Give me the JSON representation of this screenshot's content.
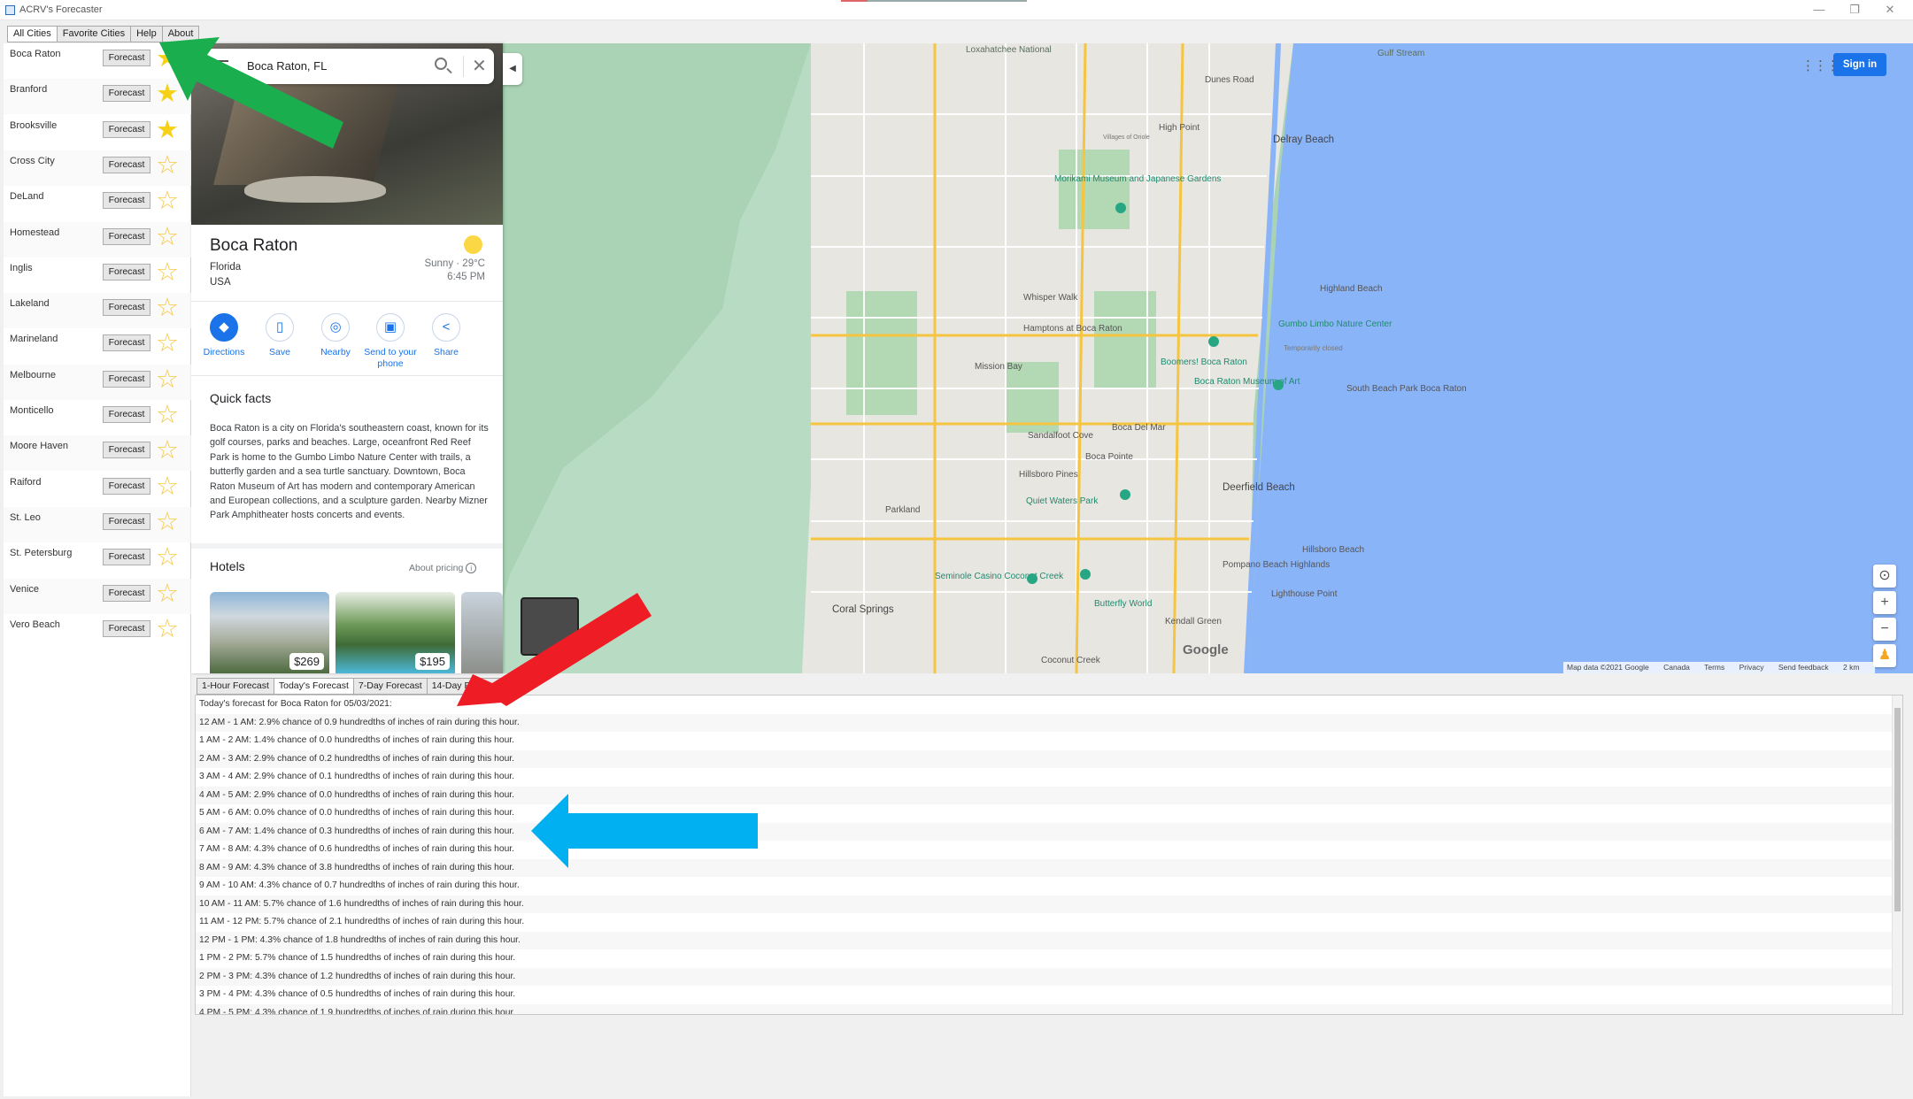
{
  "window": {
    "title": "ACRV's Forecaster"
  },
  "top_tabs": [
    "All Cities",
    "Favorite Cities",
    "Help",
    "About"
  ],
  "forecast_button_label": "Forecast",
  "cities": [
    {
      "name": "Boca Raton",
      "favorite": true
    },
    {
      "name": "Branford",
      "favorite": true
    },
    {
      "name": "Brooksville",
      "favorite": true
    },
    {
      "name": "Cross City",
      "favorite": false
    },
    {
      "name": "DeLand",
      "favorite": false
    },
    {
      "name": "Homestead",
      "favorite": false
    },
    {
      "name": "Inglis",
      "favorite": false
    },
    {
      "name": "Lakeland",
      "favorite": false
    },
    {
      "name": "Marineland",
      "favorite": false
    },
    {
      "name": "Melbourne",
      "favorite": false
    },
    {
      "name": "Monticello",
      "favorite": false
    },
    {
      "name": "Moore Haven",
      "favorite": false
    },
    {
      "name": "Raiford",
      "favorite": false
    },
    {
      "name": "St. Leo",
      "favorite": false
    },
    {
      "name": "St. Petersburg",
      "favorite": false
    },
    {
      "name": "Venice",
      "favorite": false
    },
    {
      "name": "Vero Beach",
      "favorite": false
    }
  ],
  "google_panel": {
    "search_query": "Boca Raton, FL",
    "place_name": "Boca Raton",
    "state": "Florida",
    "country": "USA",
    "weather": "Sunny · 29°C",
    "time": "6:45 PM",
    "actions": [
      {
        "label": "Directions",
        "icon": "directions-icon"
      },
      {
        "label": "Save",
        "icon": "bookmark-icon"
      },
      {
        "label": "Nearby",
        "icon": "nearby-icon"
      },
      {
        "label": "Send to your phone",
        "icon": "send-to-phone-icon"
      },
      {
        "label": "Share",
        "icon": "share-icon"
      }
    ],
    "quick_facts_title": "Quick facts",
    "quick_facts_text": "Boca Raton is a city on Florida's southeastern coast, known for its golf courses, parks and beaches. Large, oceanfront Red Reef Park is home to the Gumbo Limbo Nature Center with trails, a butterfly garden and a sea turtle sanctuary. Downtown, Boca Raton Museum of Art has modern and contemporary American and European collections, and a sculpture garden. Nearby Mizner Park Amphitheater hosts concerts and events.",
    "hotels_title": "Hotels",
    "about_pricing": "About pricing",
    "hotels": [
      {
        "price": "$269"
      },
      {
        "price": "$195"
      }
    ]
  },
  "map": {
    "sign_in": "Sign in",
    "map_labels": [
      "Loxahatchee National",
      "Gulf Stream",
      "Dunes Road",
      "Delray Beach",
      "High Point",
      "Villages of Oriole",
      "Morikami Museum and Japanese Gardens",
      "Whisper Walk",
      "Hamptons at Boca Raton",
      "Highland Beach",
      "Gumbo Limbo Nature Center",
      "Temporarily closed",
      "Boomers! Boca Raton",
      "Mission Bay",
      "Boca Raton Museum of Art",
      "South Beach Park Boca Raton",
      "Boca Del Mar",
      "Sandalfoot Cove",
      "Boca Pointe",
      "Hillsboro Pines",
      "Quiet Waters Park",
      "Deerfield Beach",
      "Parkland",
      "Hillsboro Beach",
      "Seminole Casino Coconut Creek",
      "Pompano Beach Highlands",
      "Lighthouse Point",
      "Coral Springs",
      "Butterfly World",
      "Kendall Green",
      "Coconut Creek",
      "Google"
    ],
    "attribution": [
      "Map data ©2021 Google",
      "Canada",
      "Terms",
      "Privacy",
      "Send feedback",
      "2 km"
    ],
    "colors": {
      "water": "#8ab4f8",
      "land": "#e9e6df",
      "park": "#a8d4b0",
      "wetland": "#b7dbc4"
    }
  },
  "forecast_tabs": [
    "1-Hour Forecast",
    "Today's Forecast",
    "7-Day Forecast",
    "14-Day Forecast"
  ],
  "forecast_lines": [
    "Today's forecast for Boca Raton for 05/03/2021:",
    "12 AM - 1 AM: 2.9% chance of 0.9 hundredths of inches of rain during this hour.",
    "1 AM - 2 AM: 1.4% chance of 0.0 hundredths of inches of rain during this hour.",
    "2 AM - 3 AM: 2.9% chance of 0.2 hundredths of inches of rain during this hour.",
    "3 AM - 4 AM: 2.9% chance of 0.1 hundredths of inches of rain during this hour.",
    "4 AM - 5 AM: 2.9% chance of 0.0 hundredths of inches of rain during this hour.",
    "5 AM - 6 AM: 0.0% chance of 0.0 hundredths of inches of rain during this hour.",
    "6 AM - 7 AM: 1.4% chance of 0.3 hundredths of inches of rain during this hour.",
    "7 AM - 8 AM: 4.3% chance of 0.6 hundredths of inches of rain during this hour.",
    "8 AM - 9 AM: 4.3% chance of 3.8 hundredths of inches of rain during this hour.",
    "9 AM - 10 AM: 4.3% chance of 0.7 hundredths of inches of rain during this hour.",
    "10 AM - 11 AM: 5.7% chance of 1.6 hundredths of inches of rain during this hour.",
    "11 AM - 12 PM: 5.7% chance of 2.1 hundredths of inches of rain during this hour.",
    "12 PM - 1 PM: 4.3% chance of 1.8 hundredths of inches of rain during this hour.",
    "1 PM - 2 PM: 5.7% chance of 1.5 hundredths of inches of rain during this hour.",
    "2 PM - 3 PM: 4.3% chance of 1.2 hundredths of inches of rain during this hour.",
    "3 PM - 4 PM: 4.3% chance of 0.5 hundredths of inches of rain during this hour.",
    "4 PM - 5 PM: 4.3% chance of 1.9 hundredths of inches of rain during this hour."
  ],
  "annotation_colors": {
    "green_arrow": "#1aae4e",
    "red_arrow": "#ee1c24",
    "blue_arrow": "#00b0f0"
  }
}
